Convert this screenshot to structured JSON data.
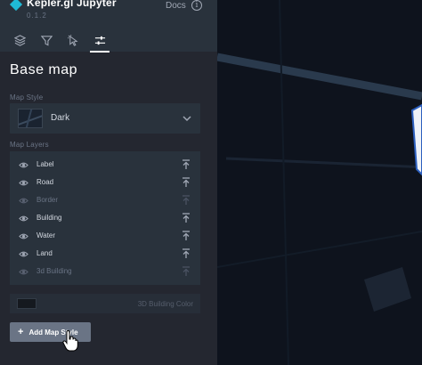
{
  "app": {
    "title": "Kepler.gl Jupyter",
    "version": "0.1.2",
    "docs_label": "Docs",
    "info_icon": "info-icon"
  },
  "tabs": [
    {
      "icon": "layers-icon",
      "active": false
    },
    {
      "icon": "filter-icon",
      "active": false
    },
    {
      "icon": "interaction-cursor-icon",
      "active": false
    },
    {
      "icon": "settings-sliders-icon",
      "active": true
    }
  ],
  "base_map": {
    "title": "Base map",
    "map_style_label": "Map Style",
    "selected_style": "Dark",
    "map_layers_label": "Map Layers",
    "layers": [
      {
        "label": "Label",
        "visible": true
      },
      {
        "label": "Road",
        "visible": true
      },
      {
        "label": "Border",
        "visible": false
      },
      {
        "label": "Building",
        "visible": true
      },
      {
        "label": "Water",
        "visible": true
      },
      {
        "label": "Land",
        "visible": true
      },
      {
        "label": "3d Building",
        "visible": false
      }
    ],
    "building_color_label": "3D Building Color",
    "add_style_label": "Add Map Style"
  },
  "colors": {
    "panel_bg": "#242730",
    "header_bg": "#29323c",
    "accent": "#1fbad6",
    "map_bg": "#0e131d",
    "road": "#2a3a4d"
  }
}
